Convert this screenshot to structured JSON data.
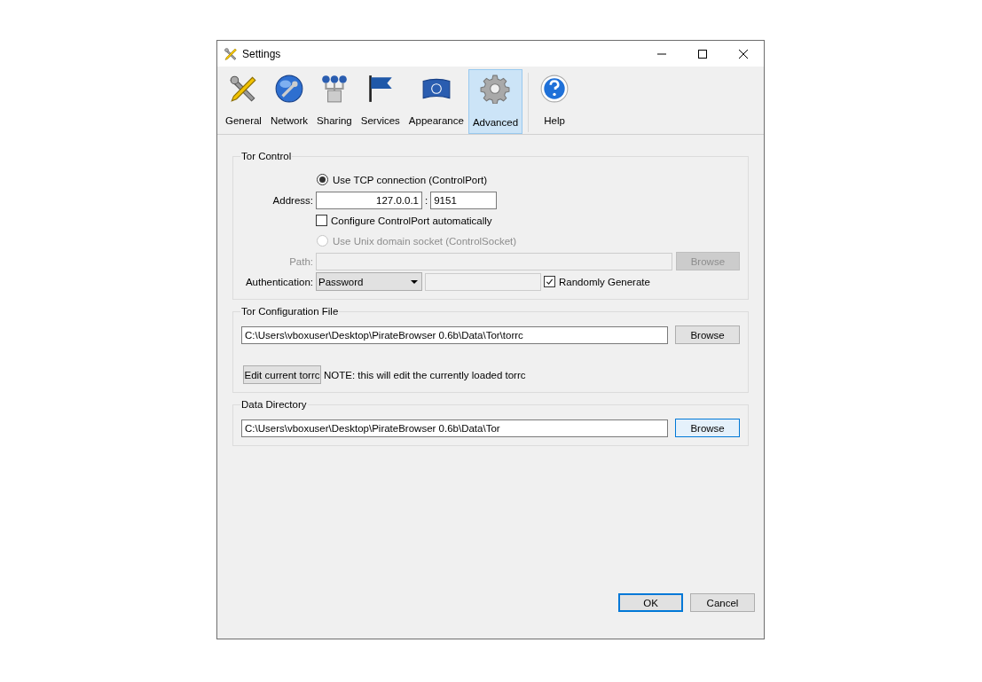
{
  "window": {
    "title": "Settings"
  },
  "tabs": [
    {
      "label": "General",
      "kind": "tools",
      "selected": false
    },
    {
      "label": "Network",
      "kind": "globe",
      "selected": false
    },
    {
      "label": "Sharing",
      "kind": "nodes",
      "selected": false
    },
    {
      "label": "Services",
      "kind": "flag",
      "selected": false
    },
    {
      "label": "Appearance",
      "kind": "banner",
      "selected": false
    },
    {
      "label": "Advanced",
      "kind": "gear",
      "selected": true
    },
    {
      "label": "Help",
      "kind": "help",
      "selected": false
    }
  ],
  "tor_control": {
    "title": "Tor Control",
    "tcp_radio": {
      "label": "Use TCP connection (ControlPort)",
      "selected": true,
      "disabled": false
    },
    "address": {
      "label": "Address:",
      "host": "127.0.0.1",
      "separator": ":",
      "port": "9151"
    },
    "configure_auto": {
      "label": "Configure ControlPort automatically",
      "checked": false
    },
    "unix_radio": {
      "label": "Use Unix domain socket (ControlSocket)",
      "selected": false,
      "disabled": true
    },
    "path": {
      "label": "Path:",
      "disabled": true
    },
    "path_browse": {
      "label": "Browse",
      "disabled": true
    },
    "authentication": {
      "label": "Authentication:",
      "value": "Password",
      "password_disabled": true
    },
    "randomly_generate": {
      "label": "Randomly Generate",
      "checked": true
    }
  },
  "tor_config": {
    "title": "Tor Configuration File",
    "path": "C:\\Users\\vboxuser\\Desktop\\PirateBrowser 0.6b\\Data\\Tor\\torrc",
    "browse": {
      "label": "Browse",
      "focused": false
    },
    "edit_button": "Edit current torrc",
    "note": "NOTE: this will edit the currently loaded torrc"
  },
  "data_directory": {
    "title": "Data Directory",
    "path": "C:\\Users\\vboxuser\\Desktop\\PirateBrowser 0.6b\\Data\\Tor",
    "browse": {
      "label": "Browse",
      "focused": true
    }
  },
  "buttons": [
    {
      "label": "OK",
      "default": true
    },
    {
      "label": "Cancel",
      "default": false
    }
  ]
}
